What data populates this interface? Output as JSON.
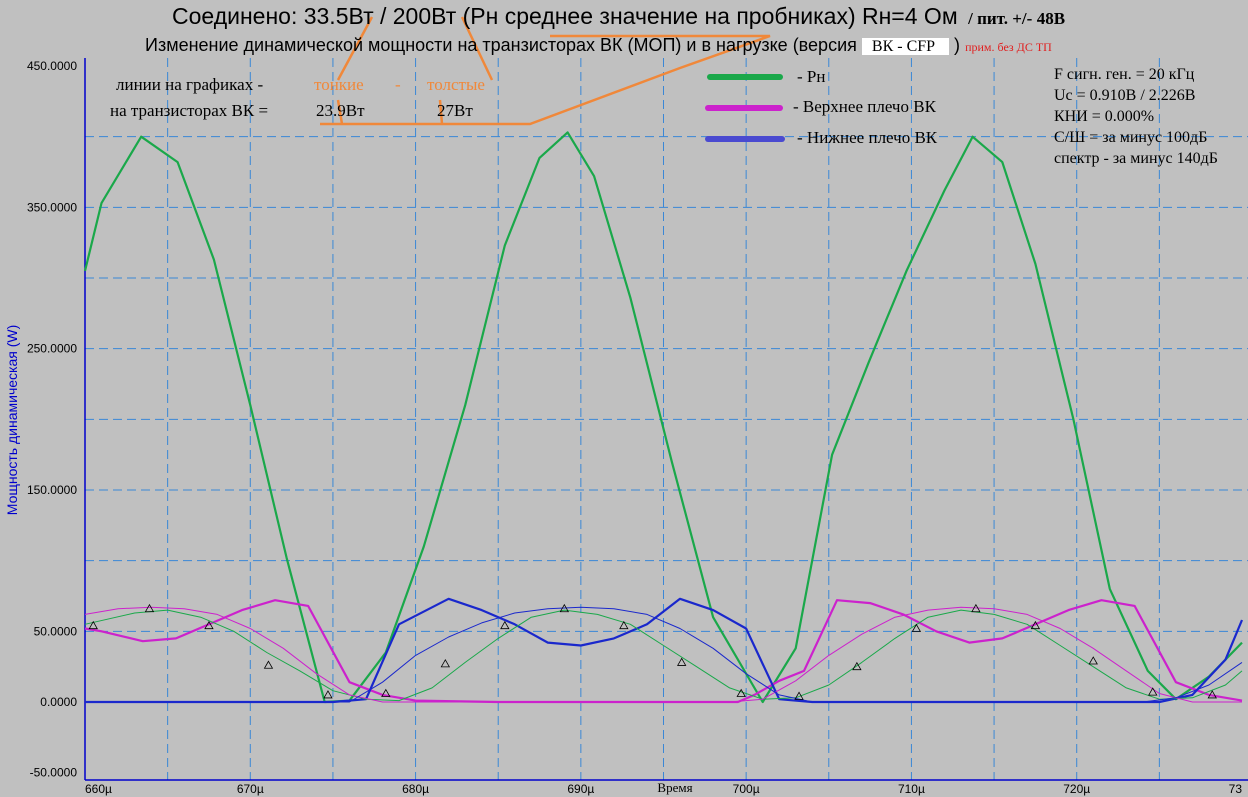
{
  "header": {
    "title_main": "Соединено: 33.5Вт / 200Вт (Рн среднее значение на пробниках) Rн=4 Ом",
    "title_supply_label": "/ пит. +/-",
    "title_supply_value": "48В",
    "subtitle": "Изменение динамической мощности  на транзисторах ВК (МОП) и в нагрузке (версия",
    "version_box": "ВК - CFP",
    "subtitle_close": ")",
    "note": "прим. без ДС ТП"
  },
  "annotations": {
    "lines_label": "линии на графиках -",
    "thin": "тонкие",
    "dash": "-",
    "thick": "толстые",
    "vk_label": "на транзисторах ВК  =",
    "thin_value": "23.9Вт",
    "thick_value": "27Вт"
  },
  "legend": {
    "pn": "- Рн",
    "upper": "- Верхнее плечо ВК",
    "lower": "- Нижнее плечо ВК"
  },
  "info": [
    "F сигн. ген. = 20 кГц",
    "Uc = 0.910В / 2.226В",
    "КНИ = 0.000%",
    "С/Ш = за минус 100дБ",
    "спектр - за минус 140дБ"
  ],
  "colors": {
    "background": "#c0c0c0",
    "grid": "#3a87d6",
    "axis": "#0000cc",
    "pn": "#1aa84a",
    "upper": "#cc22cc",
    "lower": "#1a28cc",
    "annotation": "#f0883a",
    "note": "#e02020"
  },
  "chart_data": {
    "type": "line",
    "xlabel": "Время",
    "ylabel": "Мощность динамическая (W)",
    "xlim": [
      660,
      730
    ],
    "ylim": [
      -50,
      450
    ],
    "x_ticks": [
      "660µ",
      "670µ",
      "680µ",
      "690µ",
      "700µ",
      "710µ",
      "720µ",
      "73"
    ],
    "y_ticks": [
      "450.0000",
      "350.0000",
      "250.0000",
      "150.0000",
      "50.0000",
      "0.0000",
      "-50.0000"
    ],
    "series": [
      {
        "name": "Рн",
        "style": "thick",
        "x": [
          660,
          661,
          663.4,
          665.6,
          667.8,
          670,
          672.2,
          674.5,
          676,
          678.2,
          680.5,
          683,
          685.4,
          687.5,
          689.2,
          690.8,
          693,
          695.5,
          698,
          701,
          703,
          705.2,
          707.4,
          709.7,
          712,
          713.7,
          715.5,
          717.5,
          719.8,
          722,
          724.3,
          726,
          728,
          730
        ],
        "values": [
          305,
          353,
          400,
          382,
          313,
          210,
          102,
          0,
          1,
          35,
          110,
          210,
          323,
          385,
          403,
          372,
          286,
          170,
          60,
          0,
          38,
          175,
          240,
          305,
          362,
          400,
          382,
          310,
          200,
          80,
          22,
          2,
          18,
          42
        ]
      },
      {
        "name": "Верхнее плечо ВК",
        "style": "thick",
        "x": [
          660,
          661,
          663.5,
          665.5,
          667.5,
          669.5,
          671.5,
          673.5,
          676,
          678,
          680,
          685,
          690,
          695,
          699.5,
          700.5,
          702,
          703.5,
          705.5,
          707.5,
          709.5,
          711.5,
          713.5,
          715.5,
          717.5,
          719.5,
          721.5,
          723.5,
          726,
          728,
          730
        ],
        "values": [
          52,
          50,
          43,
          45,
          55,
          65,
          72,
          68,
          14,
          5,
          1,
          0,
          0,
          0,
          0,
          5,
          15,
          22,
          72,
          70,
          62,
          50,
          42,
          45,
          55,
          65,
          72,
          68,
          14,
          5,
          1
        ]
      },
      {
        "name": "Нижнее плечо ВК",
        "style": "thick",
        "x": [
          660,
          675,
          677,
          679,
          682,
          684,
          686,
          688,
          690,
          692,
          694,
          696,
          698,
          700,
          702,
          704,
          725,
          727,
          729,
          730
        ],
        "values": [
          0,
          0,
          2,
          55,
          73,
          65,
          55,
          42,
          40,
          45,
          55,
          73,
          65,
          52,
          2,
          0,
          0,
          5,
          30,
          58
        ]
      },
      {
        "name": "Рн",
        "style": "thin",
        "x": [
          660,
          663,
          665,
          667,
          669,
          671,
          673,
          675,
          677,
          679,
          681,
          683,
          685,
          687,
          689,
          691,
          693,
          695,
          697,
          699,
          701,
          703,
          705,
          707,
          709,
          711,
          713,
          715,
          717,
          719,
          721,
          723,
          725,
          727,
          729,
          730
        ],
        "values": [
          55,
          63,
          65,
          60,
          50,
          35,
          22,
          8,
          2,
          1,
          10,
          28,
          45,
          60,
          65,
          62,
          55,
          40,
          25,
          10,
          2,
          3,
          12,
          28,
          45,
          60,
          65,
          62,
          55,
          40,
          25,
          10,
          2,
          3,
          12,
          22
        ]
      },
      {
        "name": "Верхнее плечо ВК",
        "style": "thin",
        "x": [
          660,
          662,
          664,
          666,
          668,
          670,
          672,
          674,
          676,
          678,
          680,
          685,
          690,
          695,
          699,
          701,
          703,
          705,
          707,
          709,
          711,
          713,
          715,
          717,
          719,
          721,
          723,
          725,
          727,
          730
        ],
        "values": [
          62,
          66,
          67,
          66,
          62,
          52,
          38,
          20,
          5,
          0,
          0,
          0,
          0,
          0,
          0,
          2,
          15,
          33,
          48,
          60,
          65,
          67,
          66,
          62,
          52,
          38,
          22,
          6,
          0,
          0
        ]
      },
      {
        "name": "Нижнее плечо ВК",
        "style": "thin",
        "x": [
          660,
          676,
          678,
          680,
          682,
          684,
          686,
          688,
          690,
          692,
          694,
          696,
          698,
          700,
          702,
          704,
          724,
          726,
          728,
          730
        ],
        "values": [
          0,
          0,
          14,
          33,
          46,
          56,
          63,
          66,
          67,
          66,
          62,
          52,
          38,
          20,
          5,
          0,
          0,
          3,
          12,
          28
        ]
      }
    ],
    "markers": {
      "x": [
        660.5,
        663.9,
        667.5,
        671.1,
        674.7,
        678.2,
        681.8,
        685.4,
        689,
        692.6,
        696.1,
        699.7,
        703.2,
        706.7,
        710.3,
        713.9,
        717.5,
        721,
        724.6,
        728.2
      ],
      "values": [
        54,
        66,
        54,
        26,
        5,
        6,
        27,
        54,
        66,
        54,
        28,
        6,
        4,
        25,
        52,
        66,
        54,
        29,
        7,
        5
      ]
    }
  }
}
